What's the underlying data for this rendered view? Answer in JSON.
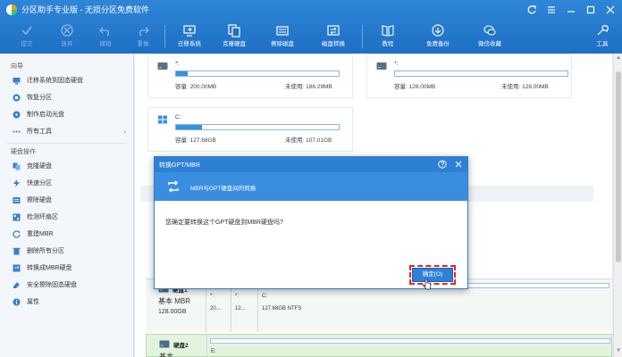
{
  "window": {
    "title": "分区助手专业版 - 无损分区免费软件",
    "controls": [
      "refresh-icon",
      "menu-icon",
      "minimize-icon",
      "maximize-icon",
      "close-icon"
    ]
  },
  "toolbar": {
    "items": [
      {
        "label": "提交",
        "icon": "submit-icon",
        "enabled": false
      },
      {
        "label": "放弃",
        "icon": "discard-icon",
        "enabled": false
      },
      {
        "label": "撤销",
        "icon": "undo-icon",
        "enabled": false
      },
      {
        "label": "重做",
        "icon": "redo-icon",
        "enabled": false
      },
      {
        "label": "迁移系统",
        "icon": "migrate-os-icon",
        "enabled": true
      },
      {
        "label": "克隆硬盘",
        "icon": "clone-disk-icon",
        "enabled": true
      },
      {
        "label": "擦除磁盘",
        "icon": "wipe-disk-icon",
        "enabled": true
      },
      {
        "label": "磁盘转换",
        "icon": "disk-convert-icon",
        "enabled": true
      },
      {
        "label": "教程",
        "icon": "tutorial-icon",
        "enabled": true
      },
      {
        "label": "免费备份",
        "icon": "free-backup-icon",
        "enabled": true
      },
      {
        "label": "微信收藏",
        "icon": "wechat-icon",
        "enabled": true
      },
      {
        "label": "工具",
        "icon": "tools-icon",
        "enabled": true
      }
    ]
  },
  "sidebar": {
    "wizard_title": "向导",
    "wizard_items": [
      {
        "label": "迁移系统到固态硬盘",
        "icon": "migrate-icon"
      },
      {
        "label": "恢复分区",
        "icon": "recover-icon"
      },
      {
        "label": "制作启动光盘",
        "icon": "bootable-disc-icon"
      },
      {
        "label": "所有工具",
        "icon": "all-tools-icon",
        "chevron": "›"
      }
    ],
    "disk_ops_title": "硬盘操作",
    "disk_items": [
      {
        "label": "克隆硬盘",
        "icon": "clone-icon"
      },
      {
        "label": "快速分区",
        "icon": "quick-partition-icon"
      },
      {
        "label": "擦除硬盘",
        "icon": "wipe-icon"
      },
      {
        "label": "检测坏扇区",
        "icon": "bad-sector-icon"
      },
      {
        "label": "重建MBR",
        "icon": "rebuild-mbr-icon"
      },
      {
        "label": "删除所有分区",
        "icon": "delete-all-icon"
      },
      {
        "label": "转换成MBR硬盘",
        "icon": "convert-mbr-icon"
      },
      {
        "label": "安全擦除固态硬盘",
        "icon": "secure-erase-icon"
      },
      {
        "label": "属性",
        "icon": "properties-icon"
      }
    ]
  },
  "partitions": [
    {
      "name": "*:",
      "capacity": "容量: 200.00MB",
      "free": "未使用: 186.29MB",
      "usage": 0.07
    },
    {
      "name": "*:",
      "capacity": "容量: 128.00MB",
      "free": "未使用: 128.00MB",
      "usage": 0.0
    },
    {
      "name": "C:",
      "capacity": "容量: 127.68GB",
      "free": "未使用: 107.01GB",
      "usage": 0.16
    }
  ],
  "disks": [
    {
      "name": "硬盘1",
      "type": "基本 MBR",
      "size": "128.00GB",
      "parts": [
        {
          "name": "*:",
          "fs": "20..."
        },
        {
          "name": "*:",
          "fs": "12..."
        },
        {
          "name": "C:",
          "fs": "127.68GB NTFS"
        }
      ]
    },
    {
      "name": "硬盘2",
      "type": "基本 ...",
      "size": "",
      "parts": [
        {
          "name": "E:",
          "fs": ""
        }
      ]
    }
  ],
  "dialog": {
    "title": "转换GPT/MBR",
    "banner_text": "MBR与GPT硬盘间的转换",
    "message": "您确定要转换这个GPT硬盘到MBR硬盘吗?",
    "ok_label": "确定(O)",
    "help_icon": "help-icon",
    "close_icon": "close-icon"
  },
  "colors": {
    "accent": "#2e80d4",
    "toolbar": "#1d6fc4",
    "highlight": "#e0252f"
  }
}
